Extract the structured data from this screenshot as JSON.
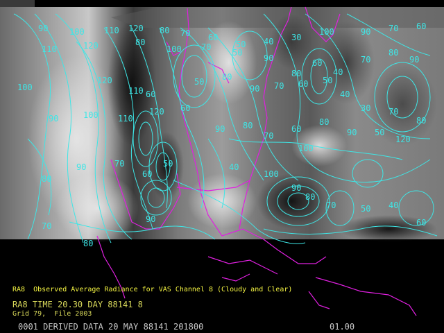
{
  "product": {
    "title_line": "RA8  Observed Average Radiance for VAS Channel 8 (Cloudy and Clear)",
    "time_line": "RA8 TIME 20.30 DAY 88141 8",
    "grid_line": "Grid 79,  File 2003"
  },
  "footer": {
    "status_left": "0001 DERIVED DATA 20 MAY 88141 201800",
    "status_right": "01.00"
  },
  "colors": {
    "background": "#000000",
    "contour": "#3ee6e6",
    "coastline": "#e020e0",
    "caption_text": "#f5f542",
    "footer_text": "#c9c9c9"
  },
  "map": {
    "type": "satellite radiance image with contour overlay",
    "contour_labels": [
      "90",
      "100",
      "110",
      "120",
      "80",
      "70",
      "60",
      "50",
      "40",
      "30",
      "100",
      "90",
      "70",
      "60",
      "110",
      "120",
      "80",
      "100",
      "70",
      "50",
      "90",
      "80",
      "60",
      "40",
      "70",
      "80",
      "90",
      "100",
      "120",
      "110",
      "60",
      "50",
      "80",
      "90",
      "70",
      "60",
      "50",
      "40",
      "30",
      "70",
      "80",
      "90",
      "100",
      "110",
      "120",
      "60",
      "90",
      "80",
      "70",
      "60",
      "80",
      "90",
      "50",
      "100",
      "120",
      "80",
      "90",
      "70",
      "60",
      "50",
      "40",
      "100",
      "90",
      "80",
      "70",
      "50",
      "40",
      "60",
      "70",
      "80",
      "90"
    ]
  }
}
